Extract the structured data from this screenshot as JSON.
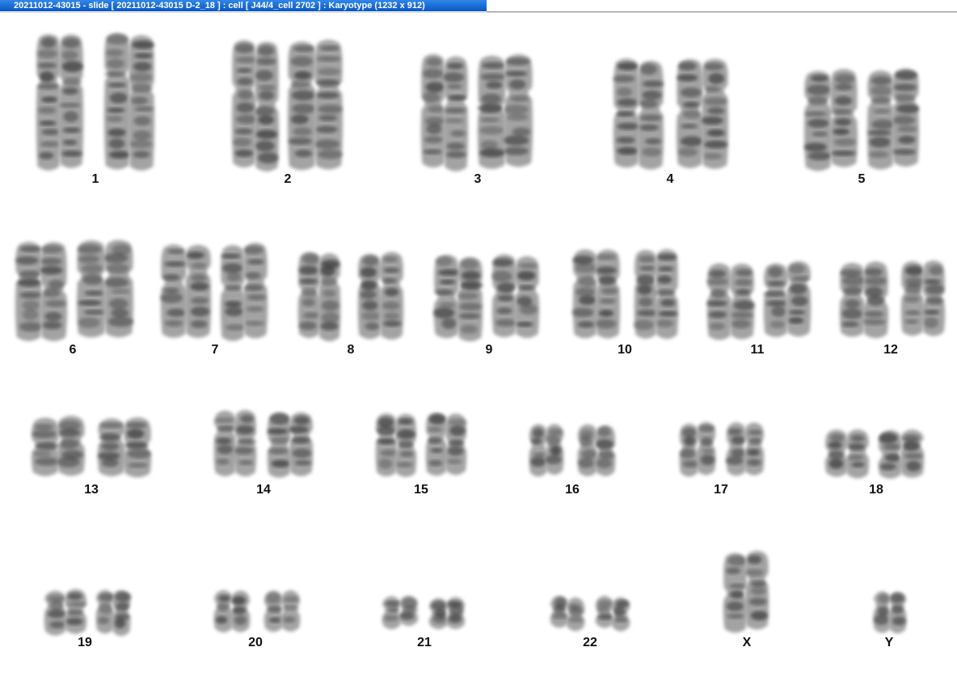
{
  "window": {
    "title": "20211012-43015 - slide [ 20211012-43015 D-2_18 ] : cell [ J44/4_cell 2702 ] : Karyotype  (1232 x 912)"
  },
  "karyotype": {
    "labels": [
      "1",
      "2",
      "3",
      "4",
      "5",
      "6",
      "7",
      "8",
      "9",
      "10",
      "11",
      "12",
      "13",
      "14",
      "15",
      "16",
      "17",
      "18",
      "19",
      "20",
      "21",
      "22",
      "X",
      "Y"
    ]
  },
  "colors": {
    "title_bar": "#0a56c4",
    "chromosome_dark": "#3a3a3a",
    "chromosome_light": "#9a9a9a"
  }
}
